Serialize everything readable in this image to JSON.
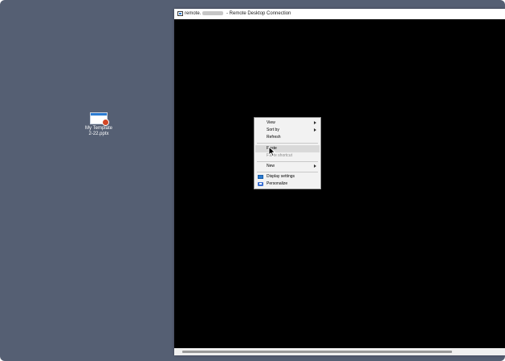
{
  "desktop": {
    "file": {
      "name_line1": "My Template",
      "name_line2": "2-22.pptx",
      "icon": "powerpoint-file-icon"
    }
  },
  "window": {
    "title_prefix": "remote.",
    "title_suffix": " - Remote Desktop Connection",
    "icon": "remote-desktop-icon"
  },
  "context_menu": {
    "items": [
      {
        "label": "View",
        "submenu": true
      },
      {
        "label": "Sort by",
        "submenu": true
      },
      {
        "label": "Refresh"
      },
      {
        "label": "Paste",
        "highlighted": true
      },
      {
        "label": "Paste shortcut",
        "disabled": true
      },
      {
        "label": "New",
        "submenu": true
      },
      {
        "label": "Display settings",
        "icon": "display-icon"
      },
      {
        "label": "Personalize",
        "icon": "personalize-icon"
      }
    ]
  },
  "colors": {
    "desktop_bg": "#555f73",
    "remote_bg": "#000000",
    "menu_bg": "#f2f2f2",
    "menu_highlight": "#d9d9d9"
  }
}
